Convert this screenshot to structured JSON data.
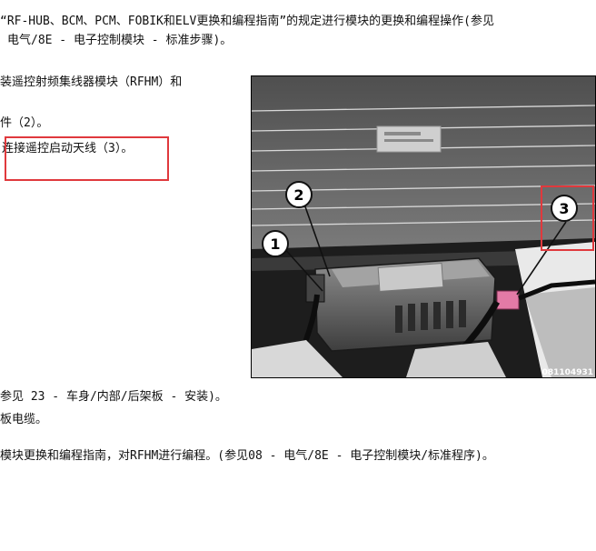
{
  "document": {
    "lines": [
      "“RF-HUB、BCM、PCM、FOBIK和ELV更换和编程指南”的规定进行模块的更换和编程操作(参见",
      "电气/8E - 电子控制模块 - 标准步骤)。",
      "装遥控射频集线器模块（RFHM）和",
      "件（2）。",
      "连接遥控启动天线（3）。",
      "参见 23 - 车身/内部/后架板 - 安装)。",
      "板电缆。",
      "模块更换和编程指南，对RFHM进行编程。(参见08 - 电气/8E - 电子控制模块/标准程序)。"
    ]
  },
  "figure": {
    "callouts": [
      "1",
      "2",
      "3"
    ],
    "figure_id": "081104931"
  },
  "colors": {
    "highlight": "#e0393d",
    "callout_fill": "#ffffff",
    "callout_stroke": "#111111"
  }
}
